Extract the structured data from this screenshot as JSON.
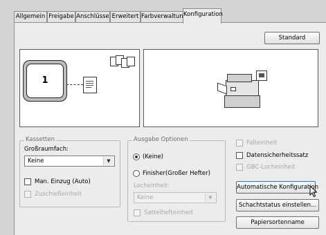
{
  "tabs": [
    {
      "label": "Allgemein"
    },
    {
      "label": "Freigabe"
    },
    {
      "label": "Anschlüsse"
    },
    {
      "label": "Erweitert"
    },
    {
      "label": "Farbverwaltung"
    },
    {
      "label": "Konfiguration",
      "active": true
    }
  ],
  "standard_button": "Standard",
  "left_preview": {
    "tray_number": "1"
  },
  "kassetten": {
    "title": "Kassetten",
    "grossraumfach_label": "Großraumfach:",
    "grossraumfach_value": "Keine",
    "man_einzug_label": "Man. Einzug (Auto)",
    "zuschiesseinheit_label": "Zuschießeinheit"
  },
  "ausgabe": {
    "title": "Ausgabe Optionen",
    "radio_keine": "(Keine)",
    "radio_finisher": "Finisher(Großer Hefter)",
    "selected": "keine",
    "locheinheit_label": "Locheinheit:",
    "locheinheit_value": "Keine",
    "sattelhefteinheit_label": "Sattelhefteinheit"
  },
  "right_options": {
    "falteinheit": "Falteinheit",
    "datensicherheitssatz": "Datensicherheitssatz",
    "gbc_locheinheit": "GBC-Locheinheit"
  },
  "buttons": {
    "auto_konfig": "Automatische Konfiguration",
    "schachtstatus": "Schachtstatus einstellen...",
    "papiersortenname": "Papiersortenname"
  }
}
